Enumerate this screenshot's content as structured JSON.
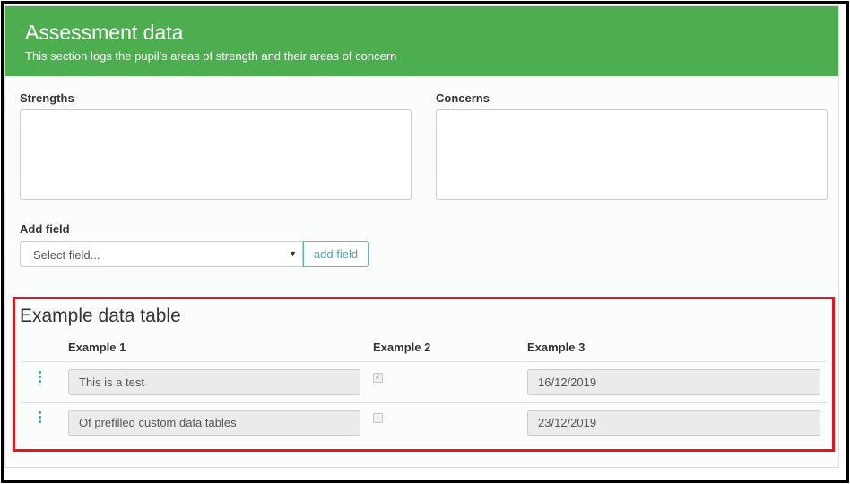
{
  "header": {
    "title": "Assessment data",
    "subtitle": "This section logs the pupil's areas of strength and their areas of concern"
  },
  "fields": {
    "strengths_label": "Strengths",
    "strengths_value": "",
    "concerns_label": "Concerns",
    "concerns_value": ""
  },
  "add_field": {
    "label": "Add field",
    "select_placeholder": "Select field...",
    "button_label": "add field"
  },
  "table": {
    "title": "Example data table",
    "columns": [
      "Example 1",
      "Example 2",
      "Example 3"
    ],
    "rows": [
      {
        "example1": "This is a test",
        "example2_checked": true,
        "example2_glyph": "✓",
        "example3": "16/12/2019"
      },
      {
        "example1": "Of prefilled custom data tables",
        "example2_checked": false,
        "example2_glyph": "",
        "example3": "23/12/2019"
      }
    ]
  },
  "colors": {
    "header_green": "#4cae4f",
    "accent_teal": "#43a9ae",
    "highlight_red": "#e8141c"
  }
}
